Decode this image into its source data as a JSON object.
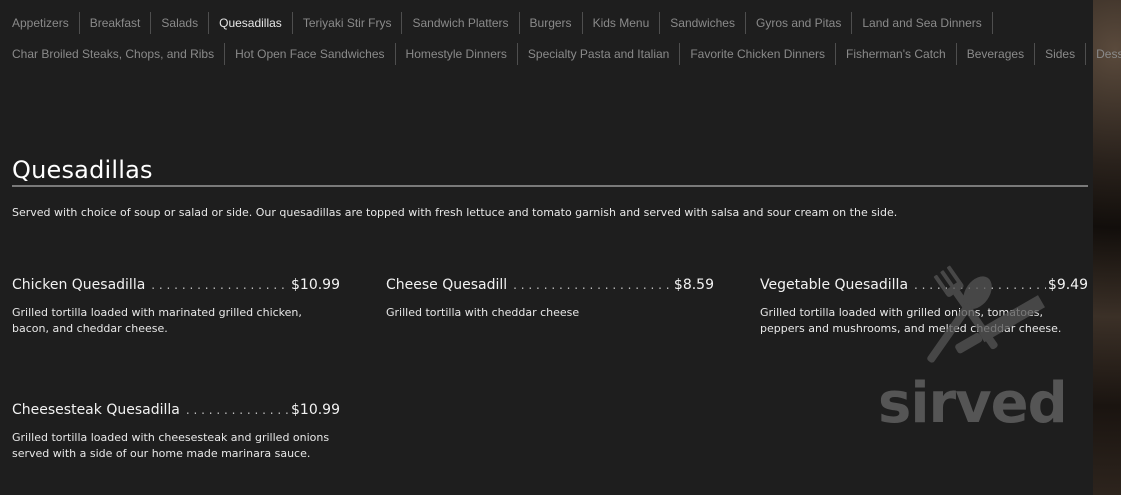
{
  "nav": {
    "row1": [
      "Appetizers",
      "Breakfast",
      "Salads",
      "Quesadillas",
      "Teriyaki Stir Frys",
      "Sandwich Platters",
      "Burgers",
      "Kids Menu",
      "Sandwiches",
      "Gyros and Pitas",
      "Land and Sea Dinners"
    ],
    "row2": [
      "Char Broiled Steaks, Chops, and Ribs",
      "Hot Open Face Sandwiches",
      "Homestyle Dinners",
      "Specialty Pasta and Italian",
      "Favorite Chicken Dinners",
      "Fisherman's Catch",
      "Beverages",
      "Sides",
      "Desserts"
    ],
    "active": "Quesadillas"
  },
  "section": {
    "title": "Quesadillas",
    "description": "Served with choice of soup or salad or side. Our quesadillas are topped with fresh lettuce and tomato garnish and served with salsa and sour cream on the side."
  },
  "items": [
    {
      "name": "Chicken Quesadilla",
      "price": "$10.99",
      "description": "Grilled tortilla loaded with marinated grilled chicken, bacon, and cheddar cheese."
    },
    {
      "name": "Cheese Quesadill",
      "price": "$8.59",
      "description": "Grilled tortilla with cheddar cheese"
    },
    {
      "name": "Vegetable Quesadilla",
      "price": "$9.49",
      "description": "Grilled tortilla loaded with grilled onions, tomatoes, peppers and mushrooms, and melted cheddar cheese."
    },
    {
      "name": "Cheesesteak Quesadilla",
      "price": "$10.99",
      "description": "Grilled tortilla loaded with cheesesteak and grilled onions served with a side of our home made marinara sauce."
    }
  ],
  "watermark": {
    "text": "sirved",
    "icon": "fork-spoon-knife-icon",
    "color": "#5a5a5a"
  },
  "colors": {
    "background": "#1e1e1e",
    "text": "#e8e8e8",
    "nav_text": "#8a8a8a",
    "rule": "#7a7a7a"
  }
}
